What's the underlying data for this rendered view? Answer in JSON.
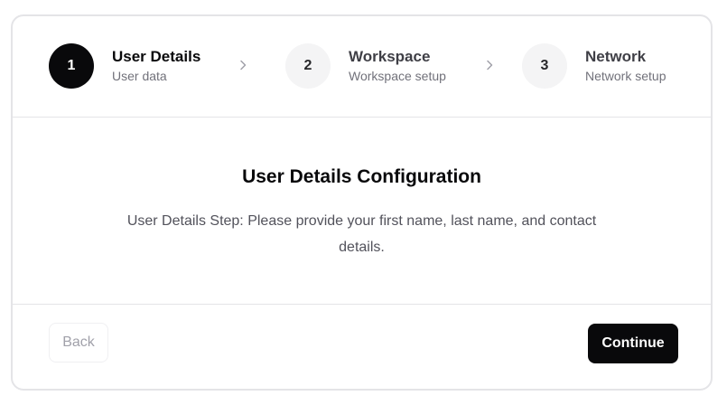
{
  "stepper": {
    "steps": [
      {
        "number": "1",
        "title": "User Details",
        "subtitle": "User data",
        "state": "active"
      },
      {
        "number": "2",
        "title": "Workspace",
        "subtitle": "Workspace setup",
        "state": "inactive"
      },
      {
        "number": "3",
        "title": "Network",
        "subtitle": "Network setup",
        "state": "inactive"
      }
    ],
    "separator_icon": "chevron-right-icon"
  },
  "content": {
    "title": "User Details Configuration",
    "description": "User Details Step: Please provide your first name, last name, and contact details."
  },
  "footer": {
    "back_label": "Back",
    "continue_label": "Continue"
  },
  "colors": {
    "primary": "#09090b",
    "muted_bg": "#f4f4f5",
    "muted_text": "#71717a",
    "border": "#e4e4e7"
  }
}
